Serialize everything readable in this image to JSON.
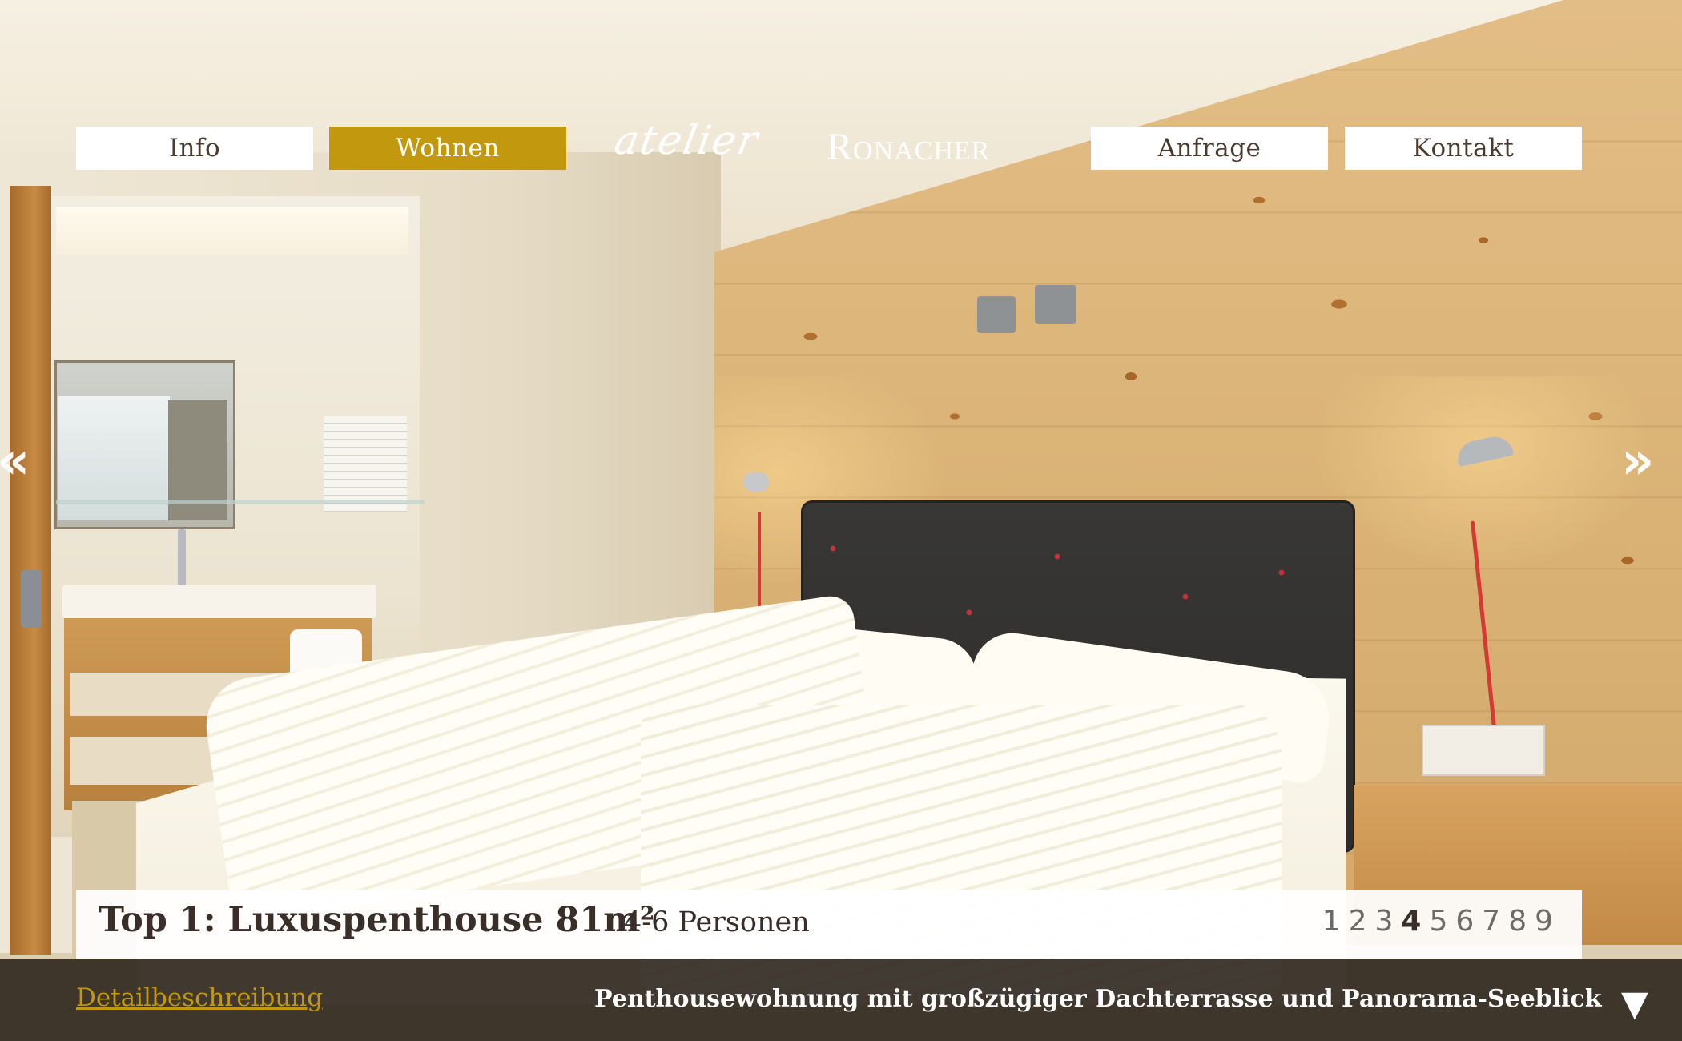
{
  "nav": {
    "items": [
      {
        "label": "Info",
        "active": false
      },
      {
        "label": "Wohnen",
        "active": true
      },
      {
        "label": "Anfrage",
        "active": false
      },
      {
        "label": "Kontakt",
        "active": false
      }
    ]
  },
  "logo": {
    "script": "atelier",
    "brand": "Ronacher"
  },
  "slider": {
    "prev_icon": "«",
    "next_icon": "»"
  },
  "apartment": {
    "title": "Top 1: Luxuspenthouse 81m²",
    "persons": "4-6 Personen",
    "pages": [
      "1",
      "2",
      "3",
      "4",
      "5",
      "6",
      "7",
      "8",
      "9"
    ],
    "current_page": "4"
  },
  "footer": {
    "detail_link": "Detailbeschreibung",
    "description": "Penthousewohnung mit großzügiger Dachterrasse und Panorama-Seeblick",
    "down_icon": "▼"
  },
  "colors": {
    "accent": "#c2990e",
    "text_dark": "#3a2f28",
    "bar_dark": "#282018"
  }
}
